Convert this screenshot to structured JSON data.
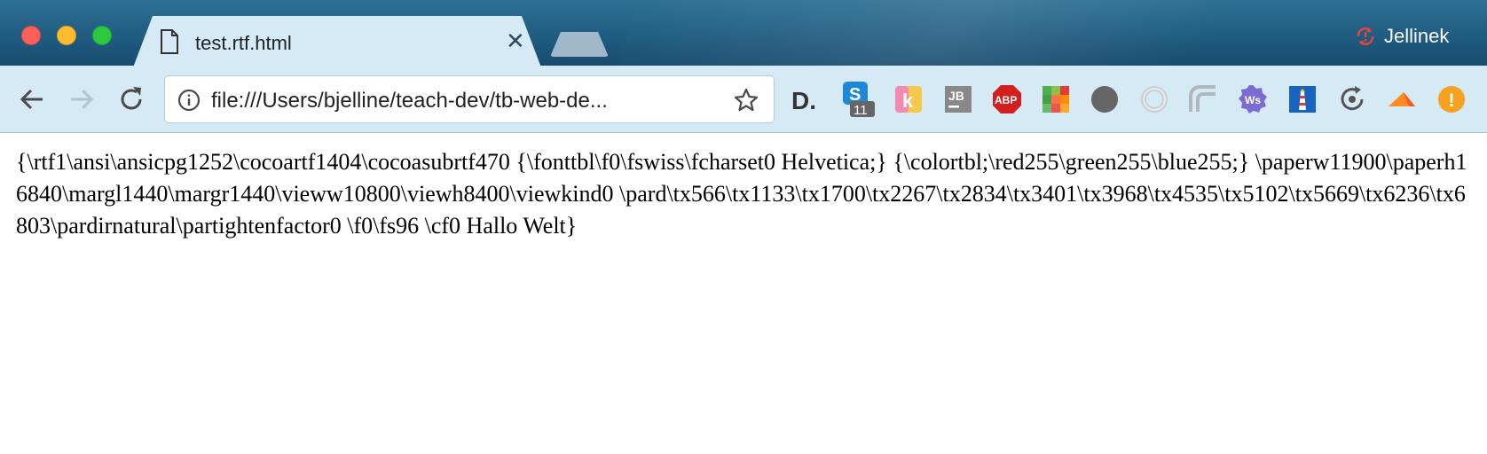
{
  "window": {
    "traffic_lights": [
      "close",
      "minimize",
      "zoom"
    ]
  },
  "tabs": [
    {
      "title": "test.rtf.html",
      "icon": "file-icon",
      "active": true
    }
  ],
  "profile": {
    "name": "Jellinek",
    "icon": "sync-error-icon",
    "color": "#e3443b"
  },
  "toolbar": {
    "back_icon": "arrow-left-icon",
    "forward_icon": "arrow-right-icon",
    "reload_icon": "reload-icon",
    "address": {
      "value": "file:///Users/bjelline/teach-dev/tb-web-de...",
      "info_icon": "info-icon",
      "bookmark_icon": "star-icon"
    },
    "extensions": [
      {
        "name": "d-extension-icon",
        "label": "D."
      },
      {
        "name": "s-extension-icon",
        "badge": "11"
      },
      {
        "name": "k-extension-icon",
        "label": "k"
      },
      {
        "name": "jetbrains-icon",
        "label": "JB"
      },
      {
        "name": "adblock-plus-icon",
        "label": "ABP"
      },
      {
        "name": "color-grid-icon"
      },
      {
        "name": "gray-circle-icon"
      },
      {
        "name": "ring-icon"
      },
      {
        "name": "rounded-square-icon"
      },
      {
        "name": "ws-extension-icon",
        "label": "Ws"
      },
      {
        "name": "lighthouse-icon"
      },
      {
        "name": "refresh-circle-icon"
      },
      {
        "name": "orange-shape-icon"
      },
      {
        "name": "alert-icon",
        "label": "!"
      }
    ]
  },
  "content": {
    "text": "{\\rtf1\\ansi\\ansicpg1252\\cocoartf1404\\cocoasubrtf470 {\\fonttbl\\f0\\fswiss\\fcharset0 Helvetica;} {\\colortbl;\\red255\\green255\\blue255;} \\paperw11900\\paperh16840\\margl1440\\margr1440\\vieww10800\\viewh8400\\viewkind0 \\pard\\tx566\\tx1133\\tx1700\\tx2267\\tx2834\\tx3401\\tx3968\\tx4535\\tx5102\\tx5669\\tx6236\\tx6803\\pardirnatural\\partightenfactor0 \\f0\\fs96 \\cf0 Hallo Welt}"
  },
  "colors": {
    "titlebar": "#1f5a80",
    "tab": "#d5eaf5",
    "page": "#ffffff"
  }
}
